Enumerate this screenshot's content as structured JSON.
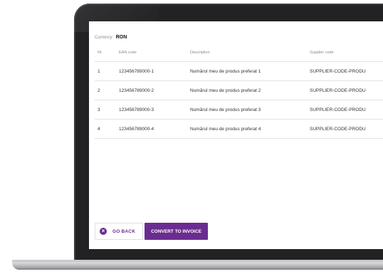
{
  "currency": {
    "label": "Currency:",
    "value": "RON"
  },
  "table": {
    "headers": {
      "nr": "Nr.",
      "ean": "EAN code",
      "description": "Description",
      "supplier": "Supplier code"
    },
    "rows": [
      {
        "nr": "1",
        "ean": "123456789000-1",
        "description": "Numărul meu de produs preferat 1",
        "supplier": "SUPPLIER-CODE-PRODU"
      },
      {
        "nr": "2",
        "ean": "123456789000-2",
        "description": "Numărul meu de produs preferat 2",
        "supplier": "SUPPLIER-CODE-PRODU"
      },
      {
        "nr": "3",
        "ean": "123456789000-3",
        "description": "Numărul meu de produs preferat 3",
        "supplier": "SUPPLIER-CODE-PRODU"
      },
      {
        "nr": "4",
        "ean": "123456789000-4",
        "description": "Numărul meu de produs preferat 4",
        "supplier": "SUPPLIER-CODE-PRODU"
      }
    ]
  },
  "actions": {
    "back_label": "GO BACK",
    "back_icon": "circle-x-icon",
    "convert_label": "CONVERT TO INVOICE"
  },
  "colors": {
    "accent": "#6b2c91",
    "bezel": "#222225"
  }
}
